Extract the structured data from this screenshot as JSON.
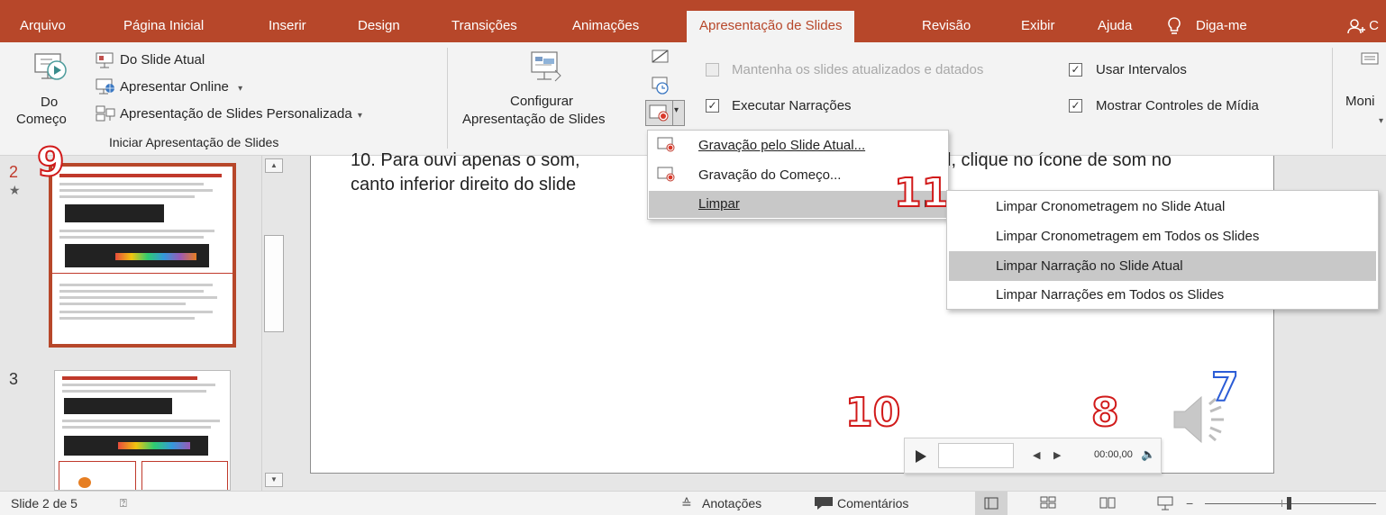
{
  "tabs": [
    {
      "label": "Arquivo",
      "active": false
    },
    {
      "label": "Página Inicial",
      "active": false
    },
    {
      "label": "Inserir",
      "active": false
    },
    {
      "label": "Design",
      "active": false
    },
    {
      "label": "Transições",
      "active": false
    },
    {
      "label": "Animações",
      "active": false
    },
    {
      "label": "Apresentação de Slides",
      "active": true
    },
    {
      "label": "Revisão",
      "active": false
    },
    {
      "label": "Exibir",
      "active": false
    },
    {
      "label": "Ajuda",
      "active": false
    }
  ],
  "tell_me": "Diga-me",
  "share_partial": "C",
  "ribbon": {
    "do_comeco_line1": "Do",
    "do_comeco_line2": "Começo",
    "do_slide_atual": "Do Slide Atual",
    "apresentar_online": "Apresentar Online",
    "personalizada": "Apresentação de Slides Personalizada",
    "group_iniciar": "Iniciar Apresentação de Slides",
    "configurar_line1": "Configurar",
    "configurar_line2": "Apresentação de Slides",
    "mantenha": "Mantenha os slides atualizados e datados",
    "executar_narracoes": "Executar Narrações",
    "usar_intervalos": "Usar Intervalos",
    "mostrar_controles": "Mostrar Controles de Mídia",
    "monitor_partial": "Moni"
  },
  "recording_menu": {
    "items": [
      {
        "label": "Gravação pelo Slide Atual..."
      },
      {
        "label": "Gravação do Começo..."
      },
      {
        "label": "Limpar"
      }
    ]
  },
  "limpar_submenu": {
    "items": [
      {
        "label": "Limpar Cronometragem no Slide Atual",
        "highlighted": false
      },
      {
        "label": "Limpar Cronometragem em Todos os Slides",
        "highlighted": false
      },
      {
        "label": "Limpar Narração no Slide Atual",
        "highlighted": true
      },
      {
        "label": "Limpar Narrações em Todos os Slides",
        "highlighted": false
      }
    ]
  },
  "thumbnails": [
    {
      "number": "2",
      "star": "★",
      "selected": true
    },
    {
      "number": "3",
      "star": "",
      "selected": false
    }
  ],
  "slide": {
    "line1_left": "10. Para ouvi apenas o som,",
    "line1_right": "l, clique no ícone de som no",
    "line2": "canto inferior direito do slide"
  },
  "media_player": {
    "time": "00:00,00"
  },
  "annotations": {
    "n9": "9",
    "n11": "11",
    "n10": "10",
    "n8": "8",
    "n7": "7"
  },
  "status": {
    "slide_info": "Slide 2 de 5",
    "anotacoes": "Anotações",
    "comentarios": "Comentários"
  },
  "colors": {
    "accent": "#b7472a",
    "annotation_red": "#d11a1a",
    "annotation_blue": "#2b5cd6",
    "menu_highlight": "#c8c8c8"
  }
}
